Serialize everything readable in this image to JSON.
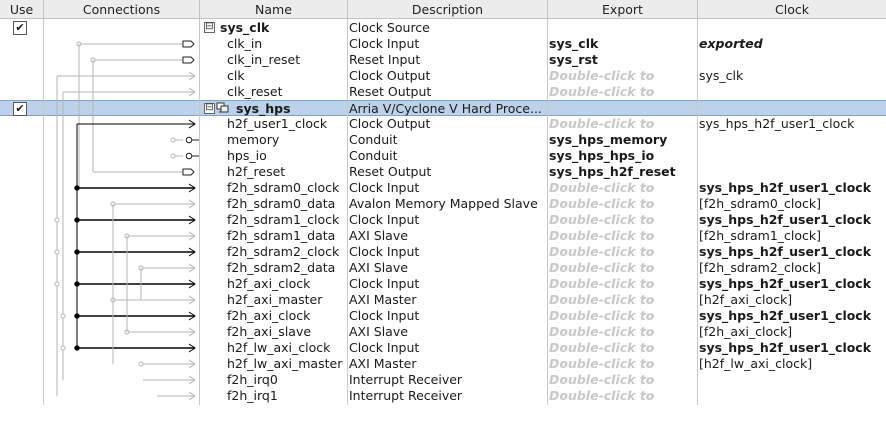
{
  "headers": [
    "Use",
    "Connections",
    "Name",
    "Description",
    "Export",
    "Clock"
  ],
  "rows": [
    {
      "use": true,
      "tree": "⊟",
      "name": "sys_clk",
      "name_bold": true,
      "description": "Clock Source",
      "export": "",
      "export_kind": "",
      "clock": "",
      "clock_kind": "",
      "selected": false
    },
    {
      "use": null,
      "name": "clk_in",
      "description": "Clock Input",
      "export": "sys_clk",
      "export_kind": "bold",
      "clock": "exported",
      "clock_kind": "exported"
    },
    {
      "use": null,
      "name": "clk_in_reset",
      "description": "Reset Input",
      "export": "sys_rst",
      "export_kind": "bold",
      "clock": "",
      "clock_kind": ""
    },
    {
      "use": null,
      "name": "clk",
      "description": "Clock Output",
      "export": "Double-click to",
      "export_kind": "hint",
      "clock": "sys_clk",
      "clock_kind": ""
    },
    {
      "use": null,
      "name": "clk_reset",
      "description": "Reset Output",
      "export": "Double-click to",
      "export_kind": "hint",
      "clock": "",
      "clock_kind": ""
    },
    {
      "use": true,
      "tree": "⊟",
      "name": "sys_hps",
      "name_bold": true,
      "description": "Arria V/Cyclone V Hard Proce...",
      "export": "",
      "export_kind": "",
      "clock": "",
      "clock_kind": "",
      "selected": true
    },
    {
      "use": null,
      "name": "h2f_user1_clock",
      "description": "Clock Output",
      "export": "Double-click to",
      "export_kind": "hint",
      "clock": "sys_hps_h2f_user1_clock",
      "clock_kind": ""
    },
    {
      "use": null,
      "name": "memory",
      "description": "Conduit",
      "export": "sys_hps_memory",
      "export_kind": "bold",
      "clock": "",
      "clock_kind": ""
    },
    {
      "use": null,
      "name": "hps_io",
      "description": "Conduit",
      "export": "sys_hps_hps_io",
      "export_kind": "bold",
      "clock": "",
      "clock_kind": ""
    },
    {
      "use": null,
      "name": "h2f_reset",
      "description": "Reset Output",
      "export": "sys_hps_h2f_reset",
      "export_kind": "bold",
      "clock": "",
      "clock_kind": ""
    },
    {
      "use": null,
      "name": "f2h_sdram0_clock",
      "description": "Clock Input",
      "export": "Double-click to",
      "export_kind": "hint",
      "clock": "sys_hps_h2f_user1_clock",
      "clock_kind": "bold"
    },
    {
      "use": null,
      "name": "f2h_sdram0_data",
      "description": "Avalon Memory Mapped Slave",
      "export": "Double-click to",
      "export_kind": "hint",
      "clock": "[f2h_sdram0_clock]",
      "clock_kind": ""
    },
    {
      "use": null,
      "name": "f2h_sdram1_clock",
      "description": "Clock Input",
      "export": "Double-click to",
      "export_kind": "hint",
      "clock": "sys_hps_h2f_user1_clock",
      "clock_kind": "bold"
    },
    {
      "use": null,
      "name": "f2h_sdram1_data",
      "description": "AXI Slave",
      "export": "Double-click to",
      "export_kind": "hint",
      "clock": "[f2h_sdram1_clock]",
      "clock_kind": ""
    },
    {
      "use": null,
      "name": "f2h_sdram2_clock",
      "description": "Clock Input",
      "export": "Double-click to",
      "export_kind": "hint",
      "clock": "sys_hps_h2f_user1_clock",
      "clock_kind": "bold"
    },
    {
      "use": null,
      "name": "f2h_sdram2_data",
      "description": "AXI Slave",
      "export": "Double-click to",
      "export_kind": "hint",
      "clock": "[f2h_sdram2_clock]",
      "clock_kind": ""
    },
    {
      "use": null,
      "name": "h2f_axi_clock",
      "description": "Clock Input",
      "export": "Double-click to",
      "export_kind": "hint",
      "clock": "sys_hps_h2f_user1_clock",
      "clock_kind": "bold"
    },
    {
      "use": null,
      "name": "h2f_axi_master",
      "description": "AXI Master",
      "export": "Double-click to",
      "export_kind": "hint",
      "clock": "[h2f_axi_clock]",
      "clock_kind": ""
    },
    {
      "use": null,
      "name": "f2h_axi_clock",
      "description": "Clock Input",
      "export": "Double-click to",
      "export_kind": "hint",
      "clock": "sys_hps_h2f_user1_clock",
      "clock_kind": "bold"
    },
    {
      "use": null,
      "name": "f2h_axi_slave",
      "description": "AXI Slave",
      "export": "Double-click to",
      "export_kind": "hint",
      "clock": "[f2h_axi_clock]",
      "clock_kind": ""
    },
    {
      "use": null,
      "name": "h2f_lw_axi_clock",
      "description": "Clock Input",
      "export": "Double-click to",
      "export_kind": "hint",
      "clock": "sys_hps_h2f_user1_clock",
      "clock_kind": "bold"
    },
    {
      "use": null,
      "name": "h2f_lw_axi_master",
      "description": "AXI Master",
      "export": "Double-click to",
      "export_kind": "hint",
      "clock": "[h2f_lw_axi_clock]",
      "clock_kind": ""
    },
    {
      "use": null,
      "name": "f2h_irq0",
      "description": "Interrupt Receiver",
      "export": "Double-click to",
      "export_kind": "hint",
      "clock": "",
      "clock_kind": ""
    },
    {
      "use": null,
      "name": "f2h_irq1",
      "description": "Interrupt Receiver",
      "export": "Double-click to",
      "export_kind": "hint",
      "clock": "",
      "clock_kind": ""
    }
  ],
  "colors": {
    "selection": "#bcd2ea",
    "header_bg": "#ececec",
    "hint_text": "#c8c8c8",
    "active_wire": "#000000",
    "inactive_wire": "#b4b4b4"
  },
  "icons": {
    "checkbox": "✔",
    "collapse": "⊟",
    "component": "hps-component-icon"
  }
}
